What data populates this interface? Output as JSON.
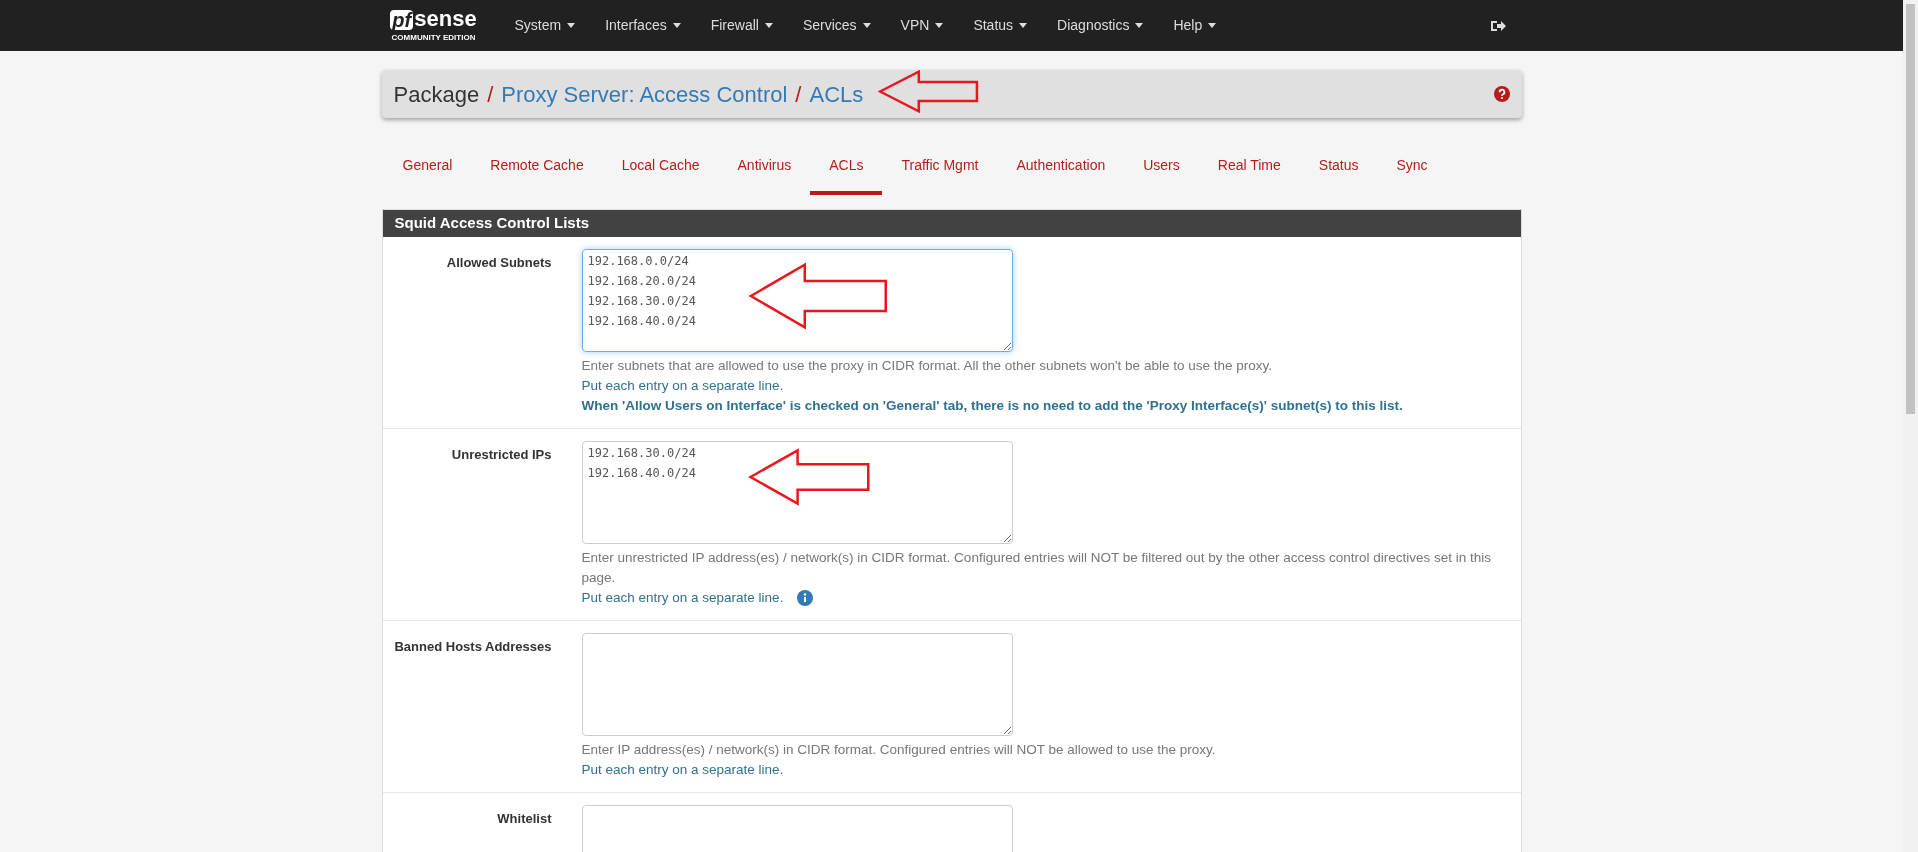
{
  "navbar": {
    "logo": {
      "mark": "pf",
      "word": "sense",
      "edition": "COMMUNITY EDITION"
    },
    "menus": [
      {
        "label": "System"
      },
      {
        "label": "Interfaces"
      },
      {
        "label": "Firewall"
      },
      {
        "label": "Services"
      },
      {
        "label": "VPN"
      },
      {
        "label": "Status"
      },
      {
        "label": "Diagnostics"
      },
      {
        "label": "Help"
      }
    ]
  },
  "breadcrumb": {
    "root": "Package",
    "separator": "/",
    "links": [
      "Proxy Server: Access Control",
      "ACLs"
    ]
  },
  "tabs": [
    {
      "label": "General",
      "selected": false
    },
    {
      "label": "Remote Cache",
      "selected": false
    },
    {
      "label": "Local Cache",
      "selected": false
    },
    {
      "label": "Antivirus",
      "selected": false
    },
    {
      "label": "ACLs",
      "selected": true
    },
    {
      "label": "Traffic Mgmt",
      "selected": false
    },
    {
      "label": "Authentication",
      "selected": false
    },
    {
      "label": "Users",
      "selected": false
    },
    {
      "label": "Real Time",
      "selected": false
    },
    {
      "label": "Status",
      "selected": false
    },
    {
      "label": "Sync",
      "selected": false
    }
  ],
  "panel": {
    "title": "Squid Access Control Lists",
    "rows": [
      {
        "label": "Allowed Subnets",
        "focused": true,
        "lines": [
          "192.168.0.0/24",
          "192.168.20.0/24",
          "192.168.30.0/24",
          "192.168.40.0/24"
        ],
        "help": [
          {
            "kind": "plain",
            "text": "Enter subnets that are allowed to use the proxy in CIDR format. All the other subnets won't be able to use the proxy."
          },
          {
            "kind": "info",
            "text": "Put each entry on a separate line."
          },
          {
            "kind": "strong",
            "text": "When 'Allow Users on Interface' is checked on 'General' tab, there is no need to add the 'Proxy Interface(s)' subnet(s) to this list."
          }
        ]
      },
      {
        "label": "Unrestricted IPs",
        "focused": false,
        "lines": [
          "192.168.30.0/24",
          "192.168.40.0/24"
        ],
        "help": [
          {
            "kind": "plain",
            "text": "Enter unrestricted IP address(es) / network(s) in CIDR format. Configured entries will NOT be filtered out by the other access control directives set in this page."
          },
          {
            "kind": "info",
            "text": "Put each entry on a separate line.",
            "info_button": true
          }
        ]
      },
      {
        "label": "Banned Hosts Addresses",
        "focused": false,
        "lines": [],
        "help": [
          {
            "kind": "plain",
            "text": "Enter IP address(es) / network(s) in CIDR format. Configured entries will NOT be allowed to use the proxy."
          },
          {
            "kind": "info",
            "text": "Put each entry on a separate line."
          }
        ]
      },
      {
        "label": "Whitelist",
        "focused": false,
        "lines": [],
        "help": []
      }
    ]
  }
}
